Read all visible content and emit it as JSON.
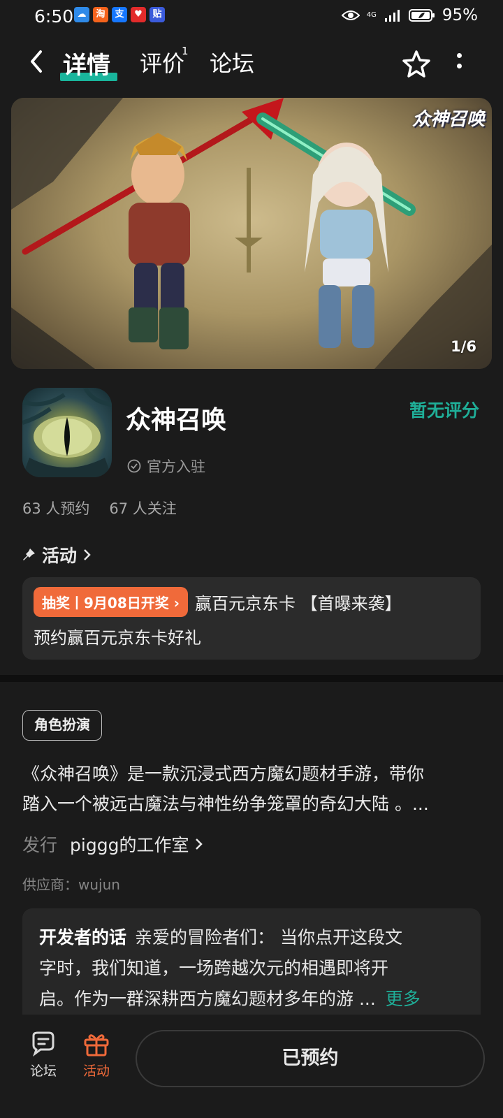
{
  "status_bar": {
    "time": "6:50",
    "notifications": [
      {
        "name": "weather-notif-icon",
        "glyph": "☁",
        "color": "#2f8ae8"
      },
      {
        "name": "taobao-notif-icon",
        "glyph": "淘",
        "color": "#f5631c"
      },
      {
        "name": "alipay-notif-icon",
        "glyph": "支",
        "color": "#1677ff"
      },
      {
        "name": "health-notif-icon",
        "glyph": "♥",
        "color": "#e22b2b"
      },
      {
        "name": "tieba-notif-icon",
        "glyph": "贴",
        "color": "#3b5bdb"
      }
    ],
    "network": "4G",
    "battery_percent": "95%"
  },
  "nav": {
    "tabs": [
      {
        "label": "详情",
        "active": true
      },
      {
        "label": "评价",
        "badge": "1"
      },
      {
        "label": "论坛"
      }
    ]
  },
  "banner": {
    "logo_text": "众神召唤",
    "page_indicator": "1/6"
  },
  "game": {
    "title": "众神召唤",
    "official_label": "官方入驻",
    "rating_text": "暂无评分",
    "reservations": "63 人预约",
    "followers": "67 人关注"
  },
  "activity": {
    "header": "活动",
    "tag": "抽奖丨9月08日开奖",
    "line1": "赢百元京东卡 【首曝来袭】",
    "line2": "预约赢百元京东卡好礼"
  },
  "details": {
    "genre_tag": "角色扮演",
    "description_line1": "《众神召唤》是一款沉浸式西方魔幻题材手游，带你",
    "description_line2": "踏入一个被远古魔法与神性纷争笼罩的奇幻大陆 。...",
    "publisher_label": "发行",
    "publisher_name": "piggg的工作室",
    "supplier": "供应商：wujun"
  },
  "developer_note": {
    "label": "开发者的话",
    "line1": "亲爱的冒险者们： 当你点开这段文",
    "line2": "字时，我们知道，一场跨越次元的相遇即将开",
    "line3": "启。作为一群深耕西方魔幻题材多年的游 ...",
    "more": "更多"
  },
  "bottom_bar": {
    "forum_label": "论坛",
    "activity_label": "活动",
    "reserve_button": "已预约"
  },
  "colors": {
    "accent": "#1fae98",
    "orange": "#f06a3a",
    "background": "#1b1b1b"
  }
}
